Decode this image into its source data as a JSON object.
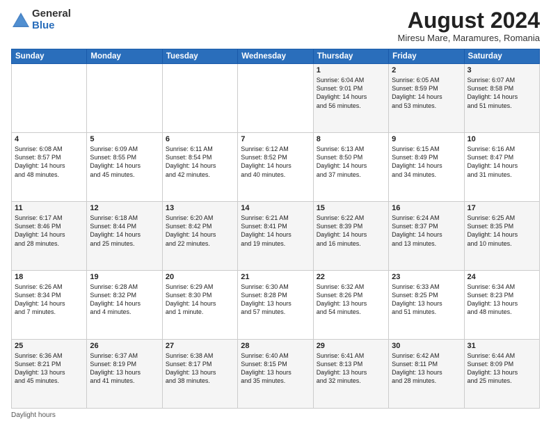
{
  "header": {
    "logo_general": "General",
    "logo_blue": "Blue",
    "month_year": "August 2024",
    "location": "Miresu Mare, Maramures, Romania"
  },
  "days_of_week": [
    "Sunday",
    "Monday",
    "Tuesday",
    "Wednesday",
    "Thursday",
    "Friday",
    "Saturday"
  ],
  "footer_label": "Daylight hours",
  "weeks": [
    [
      {
        "num": "",
        "info": ""
      },
      {
        "num": "",
        "info": ""
      },
      {
        "num": "",
        "info": ""
      },
      {
        "num": "",
        "info": ""
      },
      {
        "num": "1",
        "info": "Sunrise: 6:04 AM\nSunset: 9:01 PM\nDaylight: 14 hours\nand 56 minutes."
      },
      {
        "num": "2",
        "info": "Sunrise: 6:05 AM\nSunset: 8:59 PM\nDaylight: 14 hours\nand 53 minutes."
      },
      {
        "num": "3",
        "info": "Sunrise: 6:07 AM\nSunset: 8:58 PM\nDaylight: 14 hours\nand 51 minutes."
      }
    ],
    [
      {
        "num": "4",
        "info": "Sunrise: 6:08 AM\nSunset: 8:57 PM\nDaylight: 14 hours\nand 48 minutes."
      },
      {
        "num": "5",
        "info": "Sunrise: 6:09 AM\nSunset: 8:55 PM\nDaylight: 14 hours\nand 45 minutes."
      },
      {
        "num": "6",
        "info": "Sunrise: 6:11 AM\nSunset: 8:54 PM\nDaylight: 14 hours\nand 42 minutes."
      },
      {
        "num": "7",
        "info": "Sunrise: 6:12 AM\nSunset: 8:52 PM\nDaylight: 14 hours\nand 40 minutes."
      },
      {
        "num": "8",
        "info": "Sunrise: 6:13 AM\nSunset: 8:50 PM\nDaylight: 14 hours\nand 37 minutes."
      },
      {
        "num": "9",
        "info": "Sunrise: 6:15 AM\nSunset: 8:49 PM\nDaylight: 14 hours\nand 34 minutes."
      },
      {
        "num": "10",
        "info": "Sunrise: 6:16 AM\nSunset: 8:47 PM\nDaylight: 14 hours\nand 31 minutes."
      }
    ],
    [
      {
        "num": "11",
        "info": "Sunrise: 6:17 AM\nSunset: 8:46 PM\nDaylight: 14 hours\nand 28 minutes."
      },
      {
        "num": "12",
        "info": "Sunrise: 6:18 AM\nSunset: 8:44 PM\nDaylight: 14 hours\nand 25 minutes."
      },
      {
        "num": "13",
        "info": "Sunrise: 6:20 AM\nSunset: 8:42 PM\nDaylight: 14 hours\nand 22 minutes."
      },
      {
        "num": "14",
        "info": "Sunrise: 6:21 AM\nSunset: 8:41 PM\nDaylight: 14 hours\nand 19 minutes."
      },
      {
        "num": "15",
        "info": "Sunrise: 6:22 AM\nSunset: 8:39 PM\nDaylight: 14 hours\nand 16 minutes."
      },
      {
        "num": "16",
        "info": "Sunrise: 6:24 AM\nSunset: 8:37 PM\nDaylight: 14 hours\nand 13 minutes."
      },
      {
        "num": "17",
        "info": "Sunrise: 6:25 AM\nSunset: 8:35 PM\nDaylight: 14 hours\nand 10 minutes."
      }
    ],
    [
      {
        "num": "18",
        "info": "Sunrise: 6:26 AM\nSunset: 8:34 PM\nDaylight: 14 hours\nand 7 minutes."
      },
      {
        "num": "19",
        "info": "Sunrise: 6:28 AM\nSunset: 8:32 PM\nDaylight: 14 hours\nand 4 minutes."
      },
      {
        "num": "20",
        "info": "Sunrise: 6:29 AM\nSunset: 8:30 PM\nDaylight: 14 hours\nand 1 minute."
      },
      {
        "num": "21",
        "info": "Sunrise: 6:30 AM\nSunset: 8:28 PM\nDaylight: 13 hours\nand 57 minutes."
      },
      {
        "num": "22",
        "info": "Sunrise: 6:32 AM\nSunset: 8:26 PM\nDaylight: 13 hours\nand 54 minutes."
      },
      {
        "num": "23",
        "info": "Sunrise: 6:33 AM\nSunset: 8:25 PM\nDaylight: 13 hours\nand 51 minutes."
      },
      {
        "num": "24",
        "info": "Sunrise: 6:34 AM\nSunset: 8:23 PM\nDaylight: 13 hours\nand 48 minutes."
      }
    ],
    [
      {
        "num": "25",
        "info": "Sunrise: 6:36 AM\nSunset: 8:21 PM\nDaylight: 13 hours\nand 45 minutes."
      },
      {
        "num": "26",
        "info": "Sunrise: 6:37 AM\nSunset: 8:19 PM\nDaylight: 13 hours\nand 41 minutes."
      },
      {
        "num": "27",
        "info": "Sunrise: 6:38 AM\nSunset: 8:17 PM\nDaylight: 13 hours\nand 38 minutes."
      },
      {
        "num": "28",
        "info": "Sunrise: 6:40 AM\nSunset: 8:15 PM\nDaylight: 13 hours\nand 35 minutes."
      },
      {
        "num": "29",
        "info": "Sunrise: 6:41 AM\nSunset: 8:13 PM\nDaylight: 13 hours\nand 32 minutes."
      },
      {
        "num": "30",
        "info": "Sunrise: 6:42 AM\nSunset: 8:11 PM\nDaylight: 13 hours\nand 28 minutes."
      },
      {
        "num": "31",
        "info": "Sunrise: 6:44 AM\nSunset: 8:09 PM\nDaylight: 13 hours\nand 25 minutes."
      }
    ]
  ]
}
